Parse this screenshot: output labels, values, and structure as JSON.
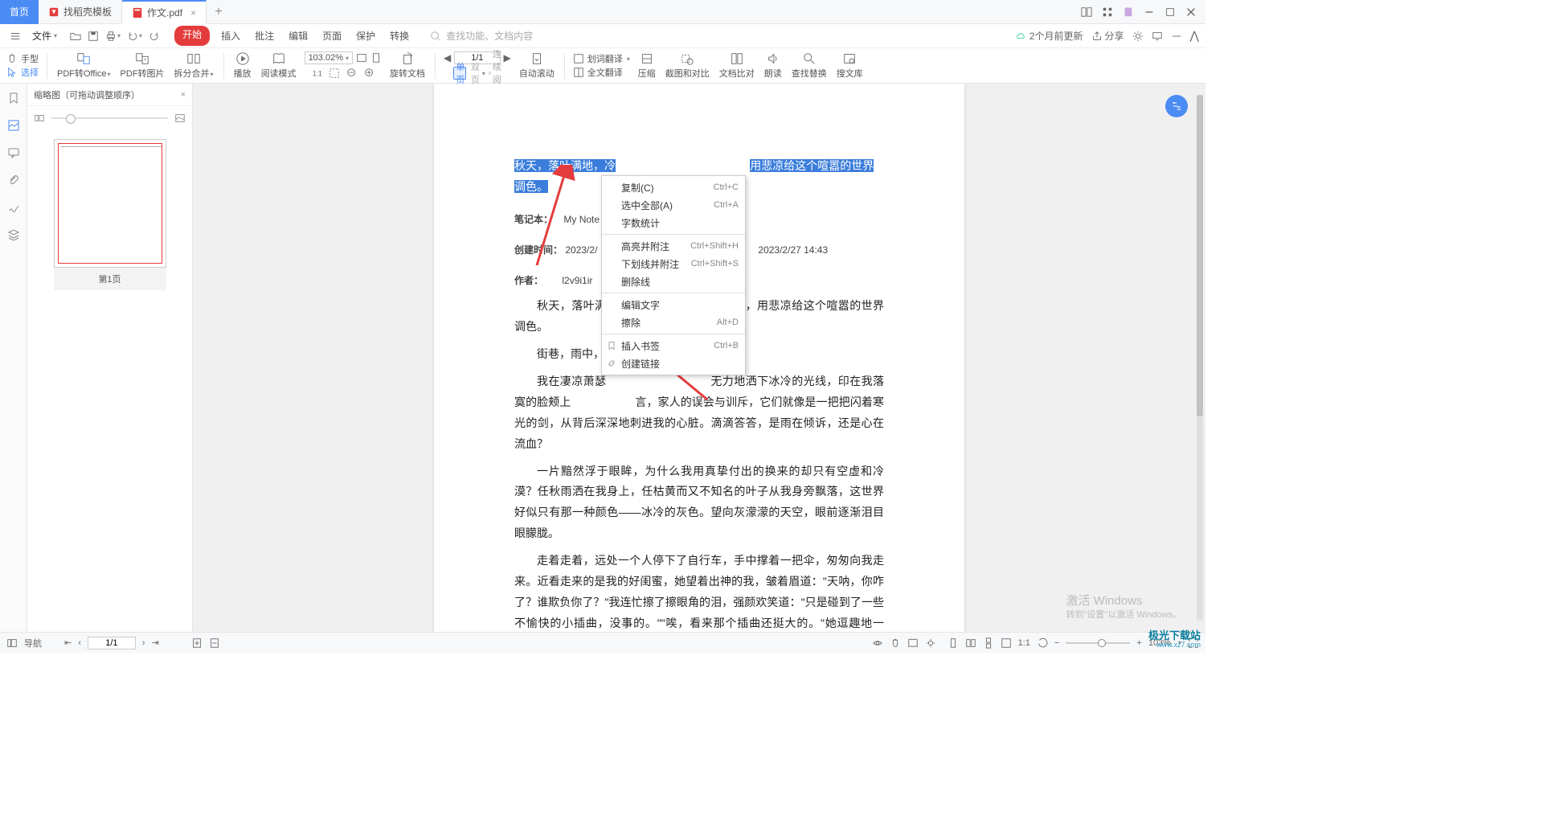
{
  "tabs": {
    "home": "首页",
    "template": "找稻壳模板",
    "active": "作文.pdf"
  },
  "menu": {
    "file": "文件",
    "start": "开始",
    "insert": "插入",
    "annotate": "批注",
    "edit": "编辑",
    "page": "页面",
    "protect": "保护",
    "convert": "转换",
    "search_hint": "查找功能、文档内容"
  },
  "menu_right": {
    "sync": "2个月前更新",
    "share": "分享"
  },
  "ribbon": {
    "hand": "手型",
    "select": "选择",
    "pdf2office": "PDF转Office",
    "pdf2img": "PDF转图片",
    "split": "拆分合并",
    "play": "播放",
    "read_mode": "阅读模式",
    "zoom": "103.02%",
    "rotate": "旋转文档",
    "single": "单页",
    "double": "双页",
    "continuous": "连续阅读",
    "page_display": "1/1",
    "auto_scroll": "自动滚动",
    "word_trans": "划词翻译",
    "full_trans": "全文翻译",
    "compress": "压缩",
    "screenshot": "截图和对比",
    "doc_compare": "文档比对",
    "read_aloud": "朗读",
    "find_replace": "查找替换",
    "search_lib": "搜文库"
  },
  "thumb_panel": {
    "title": "缩略图（可拖动调整顺序）",
    "page_label": "第1页"
  },
  "document": {
    "highlighted": "秋天，落叶满地，冷",
    "highlighted2": "用悲凉给这个喧嚣的世界调色。",
    "meta": {
      "notebook_label": "笔记本：",
      "notebook": "My Note",
      "created_label": "创建时间：",
      "created": "2023/2/",
      "modified": "2023/2/27 14:43",
      "author_label": "作者：",
      "author": "l2v9i1ir"
    },
    "p1": "秋天，落叶满",
    "p1_cont": "的情绪，用悲凉给这个喧嚣的世界调色。",
    "p2": "街巷，雨中，",
    "p3a": "我在凄凉萧瑟",
    "p3b": "无力地洒下冰冷的光线，印在我落寞的脸颊上",
    "p3c": "言，家人的误会与训斥，它们就像是一把把闪着寒光的剑，从背后深深地刺进我的心脏。滴滴答答，是雨在倾诉，还是心在流血？",
    "p4": "一片黯然浮于眼眸，为什么我用真挚付出的换来的却只有空虚和冷漠？任秋雨洒在我身上，任枯黄而又不知名的叶子从我身旁飘落，这世界好似只有那一种颜色——冰冷的灰色。望向灰濛濛的天空，眼前逐渐泪目眼朦胧。",
    "p5": "走着走着，远处一个人停下了自行车，手中撑着一把伞，匆匆向我走来。近看走来的是我的好闺蜜，她望着出神的我，皱着眉道：\"天呐，你咋了？谁欺负你了？\"我连忙擦了擦眼角的泪，强颜欢笑道：\"只是碰到了一些不愉快的小插曲，没事的。\"\"唉，看来那个插曲还挺大的。\"她逗趣地一笑，一手揽住了我的胳膊，淡淡说道：\"与其在这里做一个怨天尤人的悲观主义者，还不如做一个仰望天空，对未来充满希望的乐观主义者。\"我吸了吸鼻子答道：\"嗯\"。\"走吧，你回家先洗个澡，洗完后我带你去吃好吃的。\"\"好\"，我看着她说道。就这样我坐着她的自行车，一路冒着雨，渐渐离开这失意的场所。"
  },
  "context_menu": {
    "copy": "复制(C)",
    "copy_sc": "Ctrl+C",
    "select_all": "选中全部(A)",
    "select_all_sc": "Ctrl+A",
    "word_count": "字数统计",
    "highlight": "高亮并附注",
    "highlight_sc": "Ctrl+Shift+H",
    "underline": "下划线并附注",
    "underline_sc": "Ctrl+Shift+S",
    "strikethrough": "删除线",
    "edit_text": "编辑文字",
    "erase": "擦除",
    "erase_sc": "Alt+D",
    "bookmark": "插入书签",
    "bookmark_sc": "Ctrl+B",
    "link": "创建链接"
  },
  "status_bar": {
    "nav": "导航",
    "page": "1/1",
    "zoom": "103%"
  },
  "windows": {
    "activate": "激活 Windows",
    "hint": "转到\"设置\"以激活 Windows。"
  },
  "watermark": {
    "l1": "极光下载站",
    "l2": "www.xz7.com"
  }
}
